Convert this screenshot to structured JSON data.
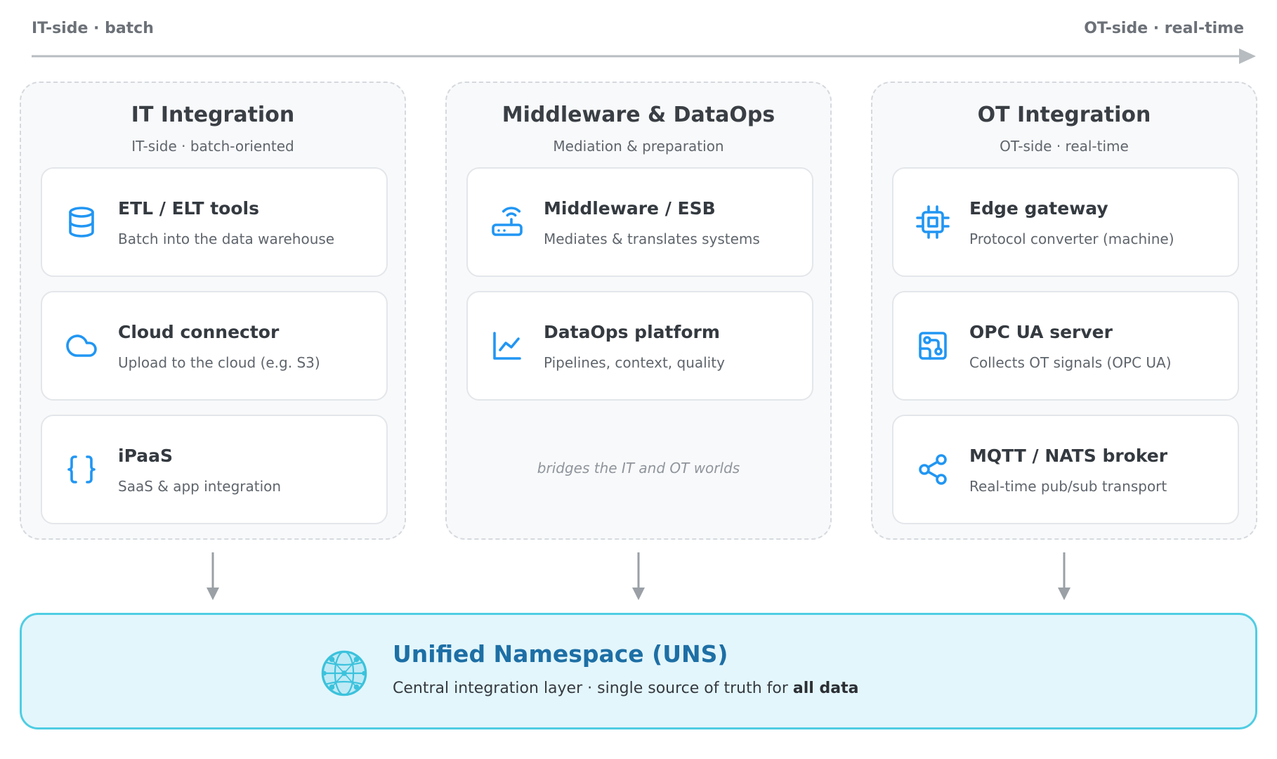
{
  "axis": {
    "left_label": "IT-side · batch",
    "right_label": "OT-side · real-time"
  },
  "colors": {
    "icon_blue": "#2196f3",
    "uns_title": "#1d6fa5",
    "uns_border": "#4fcde3",
    "uns_background": "#e3f6fc",
    "arrow_gray": "#9aa0a6"
  },
  "columns": [
    {
      "title": "IT Integration",
      "subtitle": "IT-side · batch-oriented",
      "cards": [
        {
          "icon": "database-icon",
          "title": "ETL / ELT tools",
          "desc": "Batch into the data warehouse"
        },
        {
          "icon": "cloud-icon",
          "title": "Cloud connector",
          "desc": "Upload to the cloud (e.g. S3)"
        },
        {
          "icon": "braces-icon",
          "title": "iPaaS",
          "desc": "SaaS & app integration"
        }
      ]
    },
    {
      "title": "Middleware & DataOps",
      "subtitle": "Mediation & preparation",
      "cards": [
        {
          "icon": "router-icon",
          "title": "Middleware / ESB",
          "desc": "Mediates & translates systems"
        },
        {
          "icon": "line-chart-icon",
          "title": "DataOps platform",
          "desc": "Pipelines, context, quality"
        }
      ],
      "note": "bridges the IT and OT worlds"
    },
    {
      "title": "OT Integration",
      "subtitle": "OT-side · real-time",
      "cards": [
        {
          "icon": "chip-icon",
          "title": "Edge gateway",
          "desc": "Protocol converter (machine)"
        },
        {
          "icon": "circuit-board-icon",
          "title": "OPC UA server",
          "desc": "Collects OT signals (OPC UA)"
        },
        {
          "icon": "share-nodes-icon",
          "title": "MQTT / NATS broker",
          "desc": "Real-time pub/sub transport"
        }
      ]
    }
  ],
  "uns": {
    "icon": "globe-network-icon",
    "title": "Unified Namespace (UNS)",
    "desc_prefix": "Central integration layer · single source of truth for ",
    "desc_bold": "all data"
  }
}
